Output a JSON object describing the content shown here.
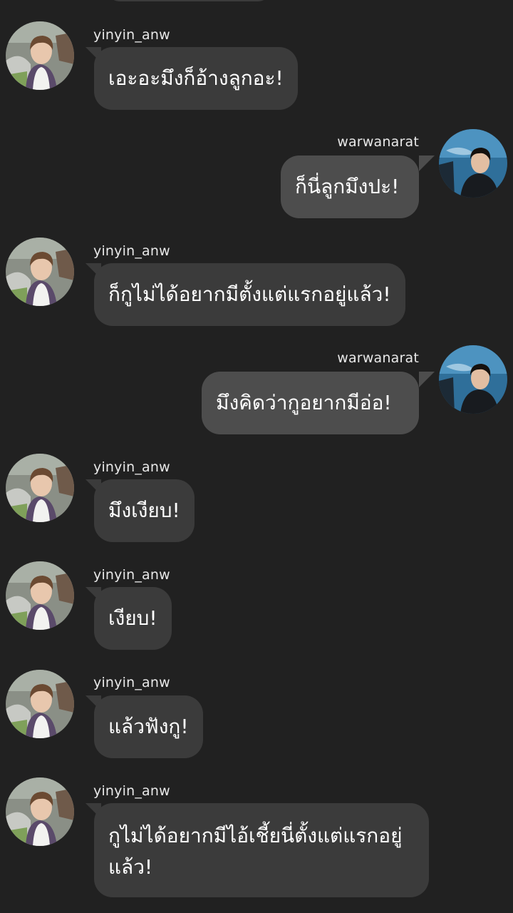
{
  "chat": {
    "messages": [
      {
        "side": "left",
        "username": "yinyin_anw",
        "text": "เอะอะมึงก็อ้างลูกอะ!",
        "avatar": "avatar-yinyin"
      },
      {
        "side": "right",
        "username": "warwanarat",
        "text": "ก็นี่ลูกมึงปะ!",
        "avatar": "avatar-warwanarat"
      },
      {
        "side": "left",
        "username": "yinyin_anw",
        "text": "ก็กูไม่ได้อยากมีตั้งแต่แรกอยู่แล้ว!",
        "avatar": "avatar-yinyin"
      },
      {
        "side": "right",
        "username": "warwanarat",
        "text": "มึงคิดว่ากูอยากมีอ่อ!",
        "avatar": "avatar-warwanarat"
      },
      {
        "side": "left",
        "username": "yinyin_anw",
        "text": "มึงเงียบ!",
        "avatar": "avatar-yinyin"
      },
      {
        "side": "left",
        "username": "yinyin_anw",
        "text": "เงียบ!",
        "avatar": "avatar-yinyin"
      },
      {
        "side": "left",
        "username": "yinyin_anw",
        "text": "แล้วฟังกู!",
        "avatar": "avatar-yinyin"
      },
      {
        "side": "left",
        "username": "yinyin_anw",
        "text": " กูไม่ได้อยากมีไอ้เชี้ยนี่ตั้งแต่แรกอยู่แล้ว!",
        "avatar": "avatar-yinyin"
      }
    ]
  },
  "colors": {
    "background": "#212121",
    "bubble_left": "#3b3b3b",
    "bubble_right": "#4d4d4d",
    "text": "#ffffff",
    "username": "#e9e9e9"
  }
}
